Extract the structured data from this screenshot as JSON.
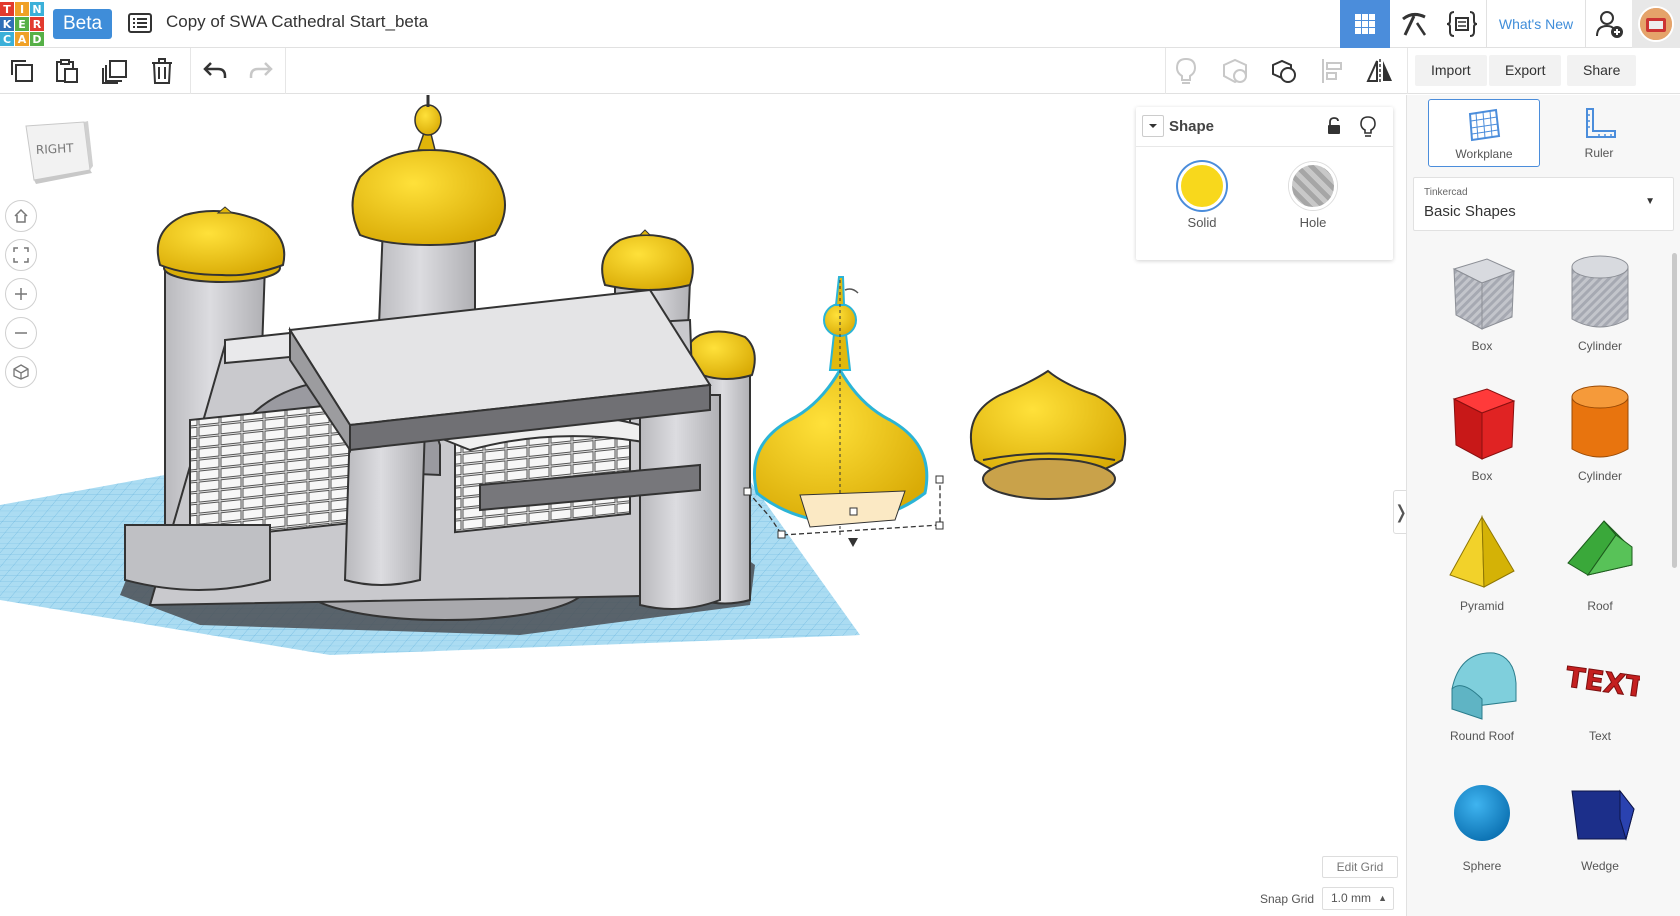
{
  "logo": {
    "letters": [
      "T",
      "I",
      "N",
      "K",
      "E",
      "R",
      "C",
      "A",
      "D"
    ]
  },
  "header": {
    "beta": "Beta",
    "title": "Copy of SWA Cathedral Start_beta",
    "whats_new": "What's New"
  },
  "toolbar": {
    "import_label": "Import",
    "export_label": "Export",
    "share_label": "Share"
  },
  "viewcube": {
    "face": "RIGHT"
  },
  "inspector": {
    "title": "Shape",
    "solid_label": "Solid",
    "hole_label": "Hole",
    "solid_color": "#f8d81c"
  },
  "grid": {
    "edit_label": "Edit Grid",
    "snap_label": "Snap Grid",
    "snap_value": "1.0 mm"
  },
  "panel": {
    "workplane_label": "Workplane",
    "ruler_label": "Ruler",
    "library_provider": "Tinkercad",
    "library_name": "Basic Shapes",
    "shapes": [
      {
        "label": "Box"
      },
      {
        "label": "Cylinder"
      },
      {
        "label": "Box"
      },
      {
        "label": "Cylinder"
      },
      {
        "label": "Pyramid"
      },
      {
        "label": "Roof"
      },
      {
        "label": "Round Roof"
      },
      {
        "label": "Text"
      },
      {
        "label": "Sphere"
      },
      {
        "label": "Wedge"
      }
    ],
    "text_shape_glyphs": "TEXT"
  },
  "colors": {
    "accent": "#4b8ddb",
    "dome": "#f2c812",
    "workplane": "#7cc4ea"
  }
}
